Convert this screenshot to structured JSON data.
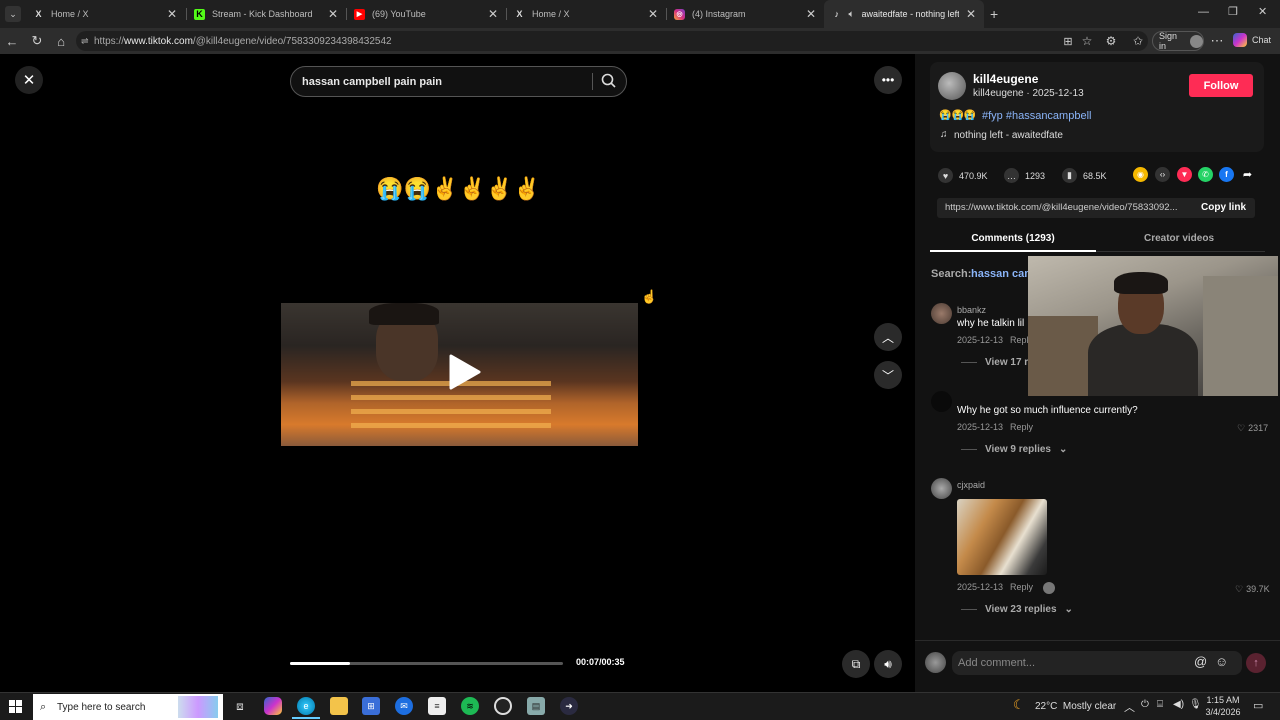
{
  "browser": {
    "tabs": [
      {
        "label": "Home / X",
        "icon": "x-logo-icon"
      },
      {
        "label": "Stream - Kick Dashboard",
        "icon": "kick-icon"
      },
      {
        "label": "(69) YouTube",
        "icon": "youtube-icon"
      },
      {
        "label": "Home / X",
        "icon": "x-logo-icon"
      },
      {
        "label": "(4) Instagram",
        "icon": "instagram-icon"
      },
      {
        "label": "awaitedfate - nothing left | Ti",
        "icon": "tiktok-icon",
        "active": true
      }
    ],
    "url_prefix": "https://",
    "url_domain": "www.tiktok.com",
    "url_path": "/@kill4eugene/video/7583309234398432542",
    "sign_in": "Sign in",
    "chat": "Chat"
  },
  "player": {
    "search_value": "hassan campbell pain pain",
    "caption_emoji": "😭😭✌✌✌✌",
    "time": "00:07/00:35",
    "progress": 0.22
  },
  "post": {
    "username": "kill4eugene",
    "handle_date": "kill4eugene · 2025-12-13",
    "follow": "Follow",
    "caption_emoji": "😭😭😭",
    "hashtags": "#fyp #hassancampbell",
    "sound": "nothing left - awaitedfate",
    "likes": "470.9K",
    "comments": "1293",
    "saves": "68.5K",
    "link": "https://www.tiktok.com/@kill4eugene/video/75833092...",
    "copy_link": "Copy link",
    "tab_comments": "Comments (1293)",
    "tab_creator": "Creator videos",
    "search_label": "Search:",
    "search_term": "hassan cam"
  },
  "comments": [
    {
      "name": "bbankz",
      "text": "why he talkin lil",
      "date": "2025-12-13",
      "reply": "Reply",
      "replies": "View 17 re"
    },
    {
      "name": "",
      "text": "Why he got so much influence currently?",
      "date": "2025-12-13",
      "reply": "Reply",
      "likes": "2317",
      "replies": "View 9 replies"
    },
    {
      "name": "cjxpaid",
      "text": "",
      "date": "2025-12-13",
      "reply": "Reply",
      "likes": "39.7K",
      "replies": "View 23 replies"
    }
  ],
  "comment_placeholder": "Add comment...",
  "taskbar": {
    "search_placeholder": "Type here to search",
    "weather": "22°C  Mostly clear",
    "time": "1:15 AM",
    "date": "3/4/2026"
  },
  "colors": {
    "accent": "#fe2c55",
    "hashtag": "#8ab4f8"
  }
}
